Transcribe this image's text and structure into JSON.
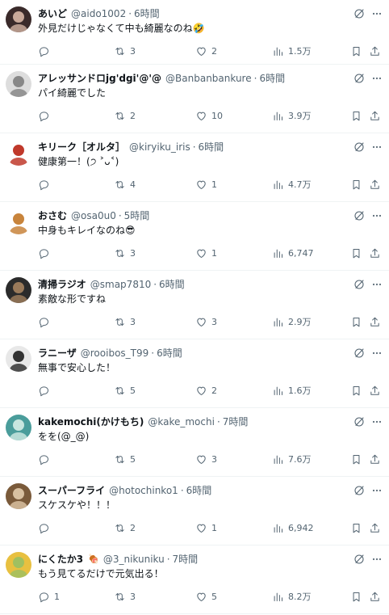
{
  "tweets": [
    {
      "name": "あいど",
      "name_emoji": "",
      "handle": "@aido1002",
      "time": "6時間",
      "text": "外見だけじゃなくて中も綺麗なのね🤣",
      "replies": "",
      "retweets": "3",
      "likes": "2",
      "views": "1.5万",
      "avatar_colors": [
        "#3a2a2a",
        "#c9a99a"
      ]
    },
    {
      "name": "アレッサンドロjg'dgi'@'@",
      "name_emoji": "",
      "handle": "@Banbanbankure",
      "time": "6時間",
      "text": "パイ綺麗でした",
      "replies": "",
      "retweets": "2",
      "likes": "10",
      "views": "3.9万",
      "avatar_colors": [
        "#dddddd",
        "#888888"
      ]
    },
    {
      "name": "キリーク［オルタ］",
      "name_emoji": "",
      "handle": "@kiryiku_iris",
      "time": "6時間",
      "text": "健康第一！(੭ ˃ᴗ˂)",
      "replies": "",
      "retweets": "4",
      "likes": "1",
      "views": "4.7万",
      "avatar_colors": [
        "#ffffff",
        "#c0392b"
      ]
    },
    {
      "name": "おさむ",
      "name_emoji": "",
      "handle": "@osa0u0",
      "time": "5時間",
      "text": "中身もキレイなのね😎",
      "replies": "",
      "retweets": "3",
      "likes": "1",
      "views": "6,747",
      "avatar_colors": [
        "#ffffff",
        "#c8843c"
      ]
    },
    {
      "name": "清掃ラジオ",
      "name_emoji": "",
      "handle": "@smap7810",
      "time": "6時間",
      "text": "素敵な形ですね",
      "replies": "",
      "retweets": "3",
      "likes": "3",
      "views": "2.9万",
      "avatar_colors": [
        "#2b2b2b",
        "#9a7a5a"
      ]
    },
    {
      "name": "ラニーザ",
      "name_emoji": "",
      "handle": "@rooibos_T99",
      "time": "6時間",
      "text": "無事で安心した！",
      "replies": "",
      "retweets": "5",
      "likes": "2",
      "views": "1.6万",
      "avatar_colors": [
        "#e8e8e8",
        "#333333"
      ]
    },
    {
      "name": "kakemochi(かけもち)",
      "name_emoji": "",
      "handle": "@kake_mochi",
      "time": "7時間",
      "text": "をを(@_@)",
      "replies": "",
      "retweets": "5",
      "likes": "3",
      "views": "7.6万",
      "avatar_colors": [
        "#4a9d9b",
        "#c8e6df"
      ]
    },
    {
      "name": "スーパーフライ",
      "name_emoji": "",
      "handle": "@hotochinko1",
      "time": "6時間",
      "text": "スケスケや！！！",
      "replies": "",
      "retweets": "2",
      "likes": "1",
      "views": "6,942",
      "avatar_colors": [
        "#7a5a3a",
        "#d8c0a0"
      ]
    },
    {
      "name": "にくたか3",
      "name_emoji": "🍖",
      "handle": "@3_nikuniku",
      "time": "7時間",
      "text": "もう見てるだけで元気出る！",
      "replies": "1",
      "retweets": "3",
      "likes": "5",
      "views": "8.2万",
      "avatar_colors": [
        "#e8c040",
        "#a0c060"
      ]
    }
  ],
  "icons": {
    "reply": "reply-icon",
    "retweet": "retweet-icon",
    "like": "like-icon",
    "views": "views-icon",
    "bookmark": "bookmark-icon",
    "share": "share-icon",
    "grok": "grok-icon",
    "more": "more-icon"
  },
  "colors": {
    "text": "#0f1419",
    "muted": "#536471",
    "divider": "#eff3f4"
  }
}
